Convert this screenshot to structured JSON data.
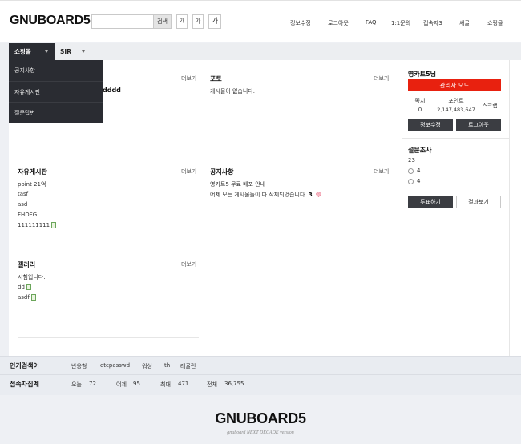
{
  "header": {
    "logo": "GNUBOARD5",
    "search_button": "검색",
    "font_small": "가",
    "font_medium": "가",
    "font_large": "가",
    "tnb": [
      "정보수정",
      "로그아웃",
      "FAQ",
      "1:1문의",
      "접속자3",
      "새글",
      "쇼핑몰"
    ]
  },
  "gnb": {
    "items": [
      "쇼핑몰",
      "SIR"
    ],
    "dropdown": [
      "공지사항",
      "자유게시판",
      "질문답변"
    ]
  },
  "latest": {
    "more": "더보기",
    "hidden_fragment": "dddd",
    "photo": {
      "title": "포토",
      "lines": [
        "게시물이 없습니다."
      ]
    },
    "free": {
      "title": "자유게시판",
      "lines": [
        "point 21억",
        "tasf",
        "asd",
        "FHDFG",
        "111111111"
      ]
    },
    "notice": {
      "title": "공지사항",
      "lines": [
        "영카트5 무료 배포 안내",
        "어제 모든 게시물들이 다 삭제되었습니다."
      ],
      "comment_count": "3"
    },
    "gallery": {
      "title": "갤러리",
      "lines": [
        "시험입니다.",
        "dd",
        "asdf"
      ]
    }
  },
  "outlogin": {
    "name": "영카트5님",
    "admin_button": "관리자 모드",
    "stats": [
      {
        "label": "쪽지",
        "value": "0"
      },
      {
        "label": "포인트",
        "value": "2,147,483,647"
      },
      {
        "label": "스크랩",
        "value": ""
      }
    ],
    "edit_button": "정보수정",
    "logout_button": "로그아웃"
  },
  "poll": {
    "title": "설문조사",
    "question": "23",
    "options": [
      "4",
      "4"
    ],
    "vote_button": "투표하기",
    "result_button": "결과보기"
  },
  "popular": {
    "label": "인기검색어",
    "keywords": [
      "반응형",
      "etcpasswd",
      "워싱",
      "th",
      "레귤런"
    ]
  },
  "visit": {
    "label": "접속자집계",
    "items": [
      {
        "label": "오늘",
        "value": "72"
      },
      {
        "label": "어제",
        "value": "95"
      },
      {
        "label": "최대",
        "value": "471"
      },
      {
        "label": "전체",
        "value": "36,755"
      }
    ]
  },
  "footer": {
    "logo": "GNUBOARD5",
    "tagline": "gnuboard NEXT DECADE version"
  },
  "colors": {
    "admin_red": "#e8210f",
    "dark_button": "#3b3d42",
    "dropdown_bg": "#2a2c32"
  }
}
